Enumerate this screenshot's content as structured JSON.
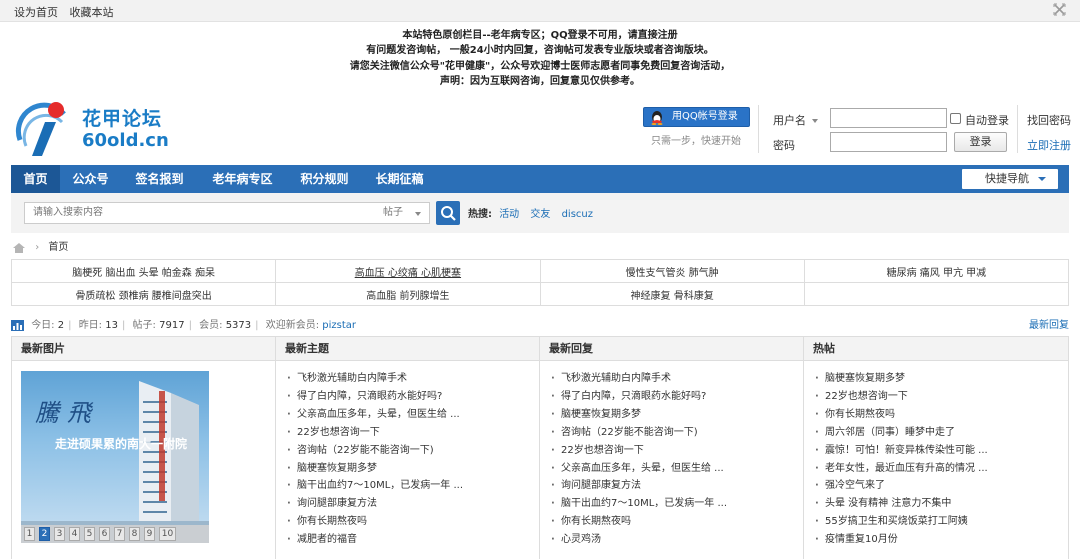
{
  "topbar": {
    "links": [
      "设为首页",
      "收藏本站"
    ]
  },
  "notice": {
    "lines": [
      "本站特色原创栏目--老年病专区；QQ登录不可用，请直接注册",
      "有问题发咨询帖， 一般24小时内回复，咨询帖可发表专业版块或者咨询版块。",
      "请您关注微信公众号\"花甲健康\"，公众号欢迎博士医师志愿者同事免费回复咨询活动，",
      "声明：因为互联网咨询，回复意见仅供参考。"
    ]
  },
  "logo": {
    "title": "花甲论坛",
    "domain": "60old.cn"
  },
  "qq": {
    "button": "用QQ帐号登录",
    "tip": "只需一步，快速开始"
  },
  "login": {
    "username_label": "用户名",
    "password_label": "密码",
    "auto_login": "自动登录",
    "submit": "登录",
    "forgot": "找回密码",
    "register": "立即注册"
  },
  "nav": {
    "items": [
      "首页",
      "公众号",
      "签名报到",
      "老年病专区",
      "积分规则",
      "长期征稿"
    ],
    "quick": "快捷导航"
  },
  "search": {
    "placeholder": "请输入搜索内容",
    "type": "帖子",
    "hot_label": "热搜:",
    "hot": [
      "活动",
      "交友",
      "discuz"
    ]
  },
  "breadcrumb": {
    "current": "首页"
  },
  "topics": [
    [
      "脑梗死 脑出血 头晕 帕金森 痴呆",
      "高血压 心绞痛 心肌梗塞",
      "慢性支气管炎 肺气肿",
      "糖尿病 痛风 甲亢 甲减"
    ],
    [
      "骨质疏松 颈椎病 腰椎间盘突出",
      "高血脂 前列腺增生",
      "神经康复 骨科康复",
      ""
    ]
  ],
  "stats": {
    "today_label": "今日:",
    "today": "2",
    "yesterday_label": "昨日:",
    "yesterday": "13",
    "posts_label": "帖子:",
    "posts": "7917",
    "members_label": "会员:",
    "members": "5373",
    "welcome_label": "欢迎新会员:",
    "new_member": "pizstar",
    "latest_reply": "最新回复"
  },
  "panels": {
    "images": {
      "title": "最新图片",
      "slide_numbers": [
        "1",
        "2",
        "3",
        "4",
        "5",
        "6",
        "7",
        "8",
        "9",
        "10"
      ],
      "active_index": 1,
      "slide_text": [
        "騰飛",
        "走进硕果累的南大一附院"
      ]
    },
    "threads": {
      "title": "最新主题",
      "items": [
        "飞秒激光辅助白内障手术",
        "得了白内障，只滴眼药水能好吗?",
        "父亲高血压多年，头晕，但医生给 ...",
        "22岁也想咨询一下",
        "咨询帖（22岁能不能咨询一下)",
        "脑梗塞恢复期多梦",
        "脑干出血约7～10ML，已发病一年 ...",
        "询问腿部康复方法",
        "你有长期熬夜吗",
        "减肥者的福音"
      ]
    },
    "replies": {
      "title": "最新回复",
      "items": [
        "飞秒激光辅助白内障手术",
        "得了白内障，只滴眼药水能好吗?",
        "脑梗塞恢复期多梦",
        "咨询帖（22岁能不能咨询一下)",
        "22岁也想咨询一下",
        "父亲高血压多年，头晕，但医生给 ...",
        "询问腿部康复方法",
        "脑干出血约7～10ML，已发病一年 ...",
        "你有长期熬夜吗",
        "心灵鸡汤"
      ]
    },
    "hot": {
      "title": "热帖",
      "items": [
        "脑梗塞恢复期多梦",
        "22岁也想咨询一下",
        "你有长期熬夜吗",
        "周六邻居（同事）睡梦中走了",
        "震惊！可怕！新变异株传染性可能 ...",
        "老年女性，最近血压有升高的情况 ...",
        "强冷空气来了",
        "头晕 没有精神 注意力不集中",
        "55岁搞卫生和买烧饭菜打工阿姨",
        "疫情重复10月份"
      ]
    }
  },
  "colors": {
    "brand_blue": "#2b6fb7",
    "logo_red": "#e52b2b",
    "link_blue": "#1a6db5"
  },
  "icons": [
    "close-icon",
    "logo-icon",
    "qq-penguin-icon",
    "search-icon",
    "home-icon",
    "stats-chart-icon",
    "chevron-down-icon"
  ]
}
